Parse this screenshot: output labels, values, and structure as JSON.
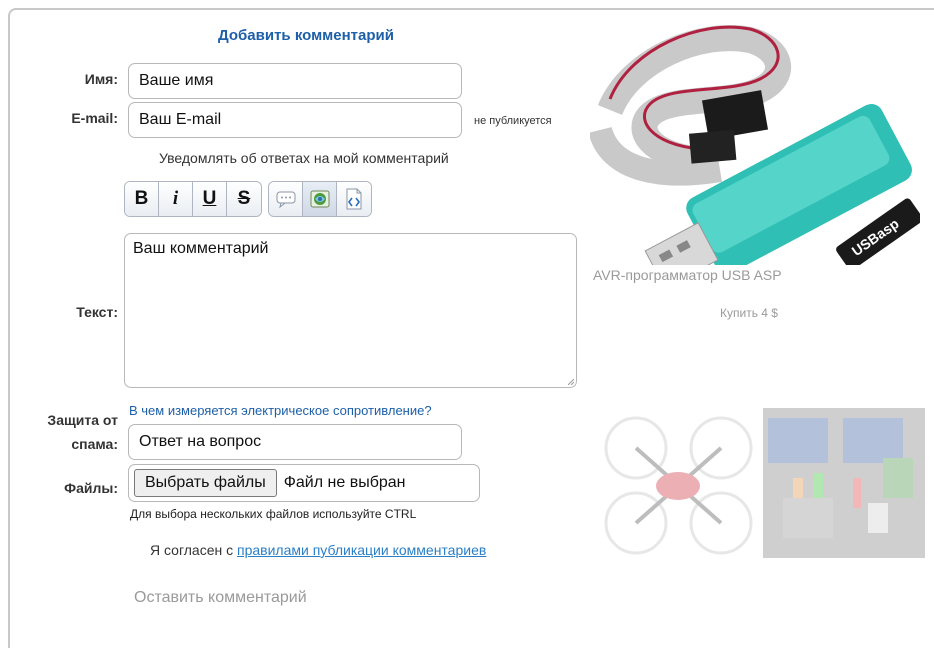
{
  "form": {
    "heading": "Добавить комментарий",
    "name_label": "Имя:",
    "name_placeholder": "Ваше имя",
    "email_label": "E-mail:",
    "email_placeholder": "Ваш E-mail",
    "email_note": "не публикуется",
    "notify_text": "Уведомлять об ответах на мой комментарий",
    "toolbar": {
      "bold": "B",
      "italic": "i",
      "underline": "U",
      "strike": "S",
      "icons": [
        "quote-icon",
        "image-icon",
        "code-icon"
      ]
    },
    "text_label": "Текст:",
    "text_placeholder": "Ваш комментарий",
    "spam_label_line1": "Защита от",
    "spam_label_line2": "спама:",
    "spam_question": "В чем измеряется электрическое сопротивление?",
    "spam_placeholder": "Ответ на вопрос",
    "files_label": "Файлы:",
    "file_button": "Выбрать файлы",
    "file_status": "Файл не выбран",
    "files_hint": "Для выбора нескольких файлов используйте CTRL",
    "agree_text": "Я согласен с",
    "agree_link": "правилами публикации комментариев",
    "submit": "Оставить комментарий"
  },
  "sidebar": {
    "product_title": "AVR-программатор USB ASP",
    "product_buy": "Купить 4 $",
    "product_logo_text": "USBasp"
  },
  "colors": {
    "heading": "#1d5fa8",
    "link": "#2a7fc6",
    "muted": "#9a9a9a",
    "border": "#b8b8b8"
  }
}
